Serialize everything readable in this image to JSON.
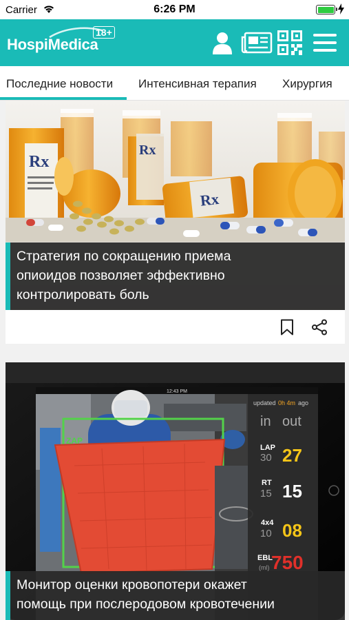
{
  "status_bar": {
    "carrier": "Carrier",
    "time": "6:26 PM"
  },
  "header": {
    "logo_text": "HospiMedica",
    "logo_badge": "18+",
    "brand_color": "#1abbb7",
    "icons": [
      "user-icon",
      "newspaper-icon",
      "qr-code-icon",
      "menu-icon"
    ]
  },
  "tabs": [
    {
      "label": "Последние новости",
      "active": true
    },
    {
      "label": "Интенсивная терапия",
      "active": false
    },
    {
      "label": "Хирургия",
      "active": false
    }
  ],
  "articles": [
    {
      "title_lines": [
        "Стратегия по сокращению приема",
        "опиоидов позволяет эффективно",
        "контролировать боль"
      ],
      "image": "prescription-pill-bottles",
      "label_on_image": "Rx",
      "actions": [
        "bookmark-icon",
        "share-icon"
      ]
    },
    {
      "title_lines": [
        "Монитор оценки кровопотери окажет",
        "помощь при послеродовом кровотечении"
      ],
      "image": "tablet-blood-loss-monitor",
      "tablet_screen": {
        "time": "12:43 PM",
        "updated_prefix": "updated",
        "updated_value": "0h 4m",
        "updated_suffix": "ago",
        "columns": [
          "in",
          "out"
        ],
        "overlay_label": "ZAP",
        "rows": [
          {
            "label": "LAP",
            "in": "30",
            "out": "27"
          },
          {
            "label": "RT",
            "in": "15",
            "out": "15"
          },
          {
            "label": "4x4",
            "in": "10",
            "out": "08"
          },
          {
            "label": "EBL",
            "unit": "(ml)",
            "out": "750"
          }
        ]
      }
    }
  ]
}
